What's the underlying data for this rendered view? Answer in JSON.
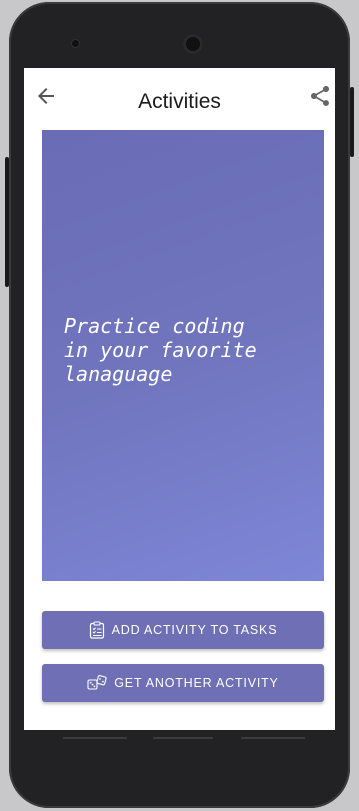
{
  "app_bar": {
    "title": "Activities",
    "back_icon": "arrow-left-icon",
    "share_icon": "share-icon"
  },
  "activity": {
    "text": "Practice coding\nin your favorite\nlanaguage",
    "gradient_colors": [
      "#6a6cb5",
      "#7e86d8"
    ]
  },
  "actions": {
    "add_label": "ADD ACTIVITY TO TASKS",
    "add_icon": "clipboard-list-icon",
    "get_label": "GET ANOTHER ACTIVITY",
    "get_icon": "dice-icon"
  },
  "colors": {
    "button_bg": "#6e6fb4",
    "button_text": "#ffffff"
  }
}
